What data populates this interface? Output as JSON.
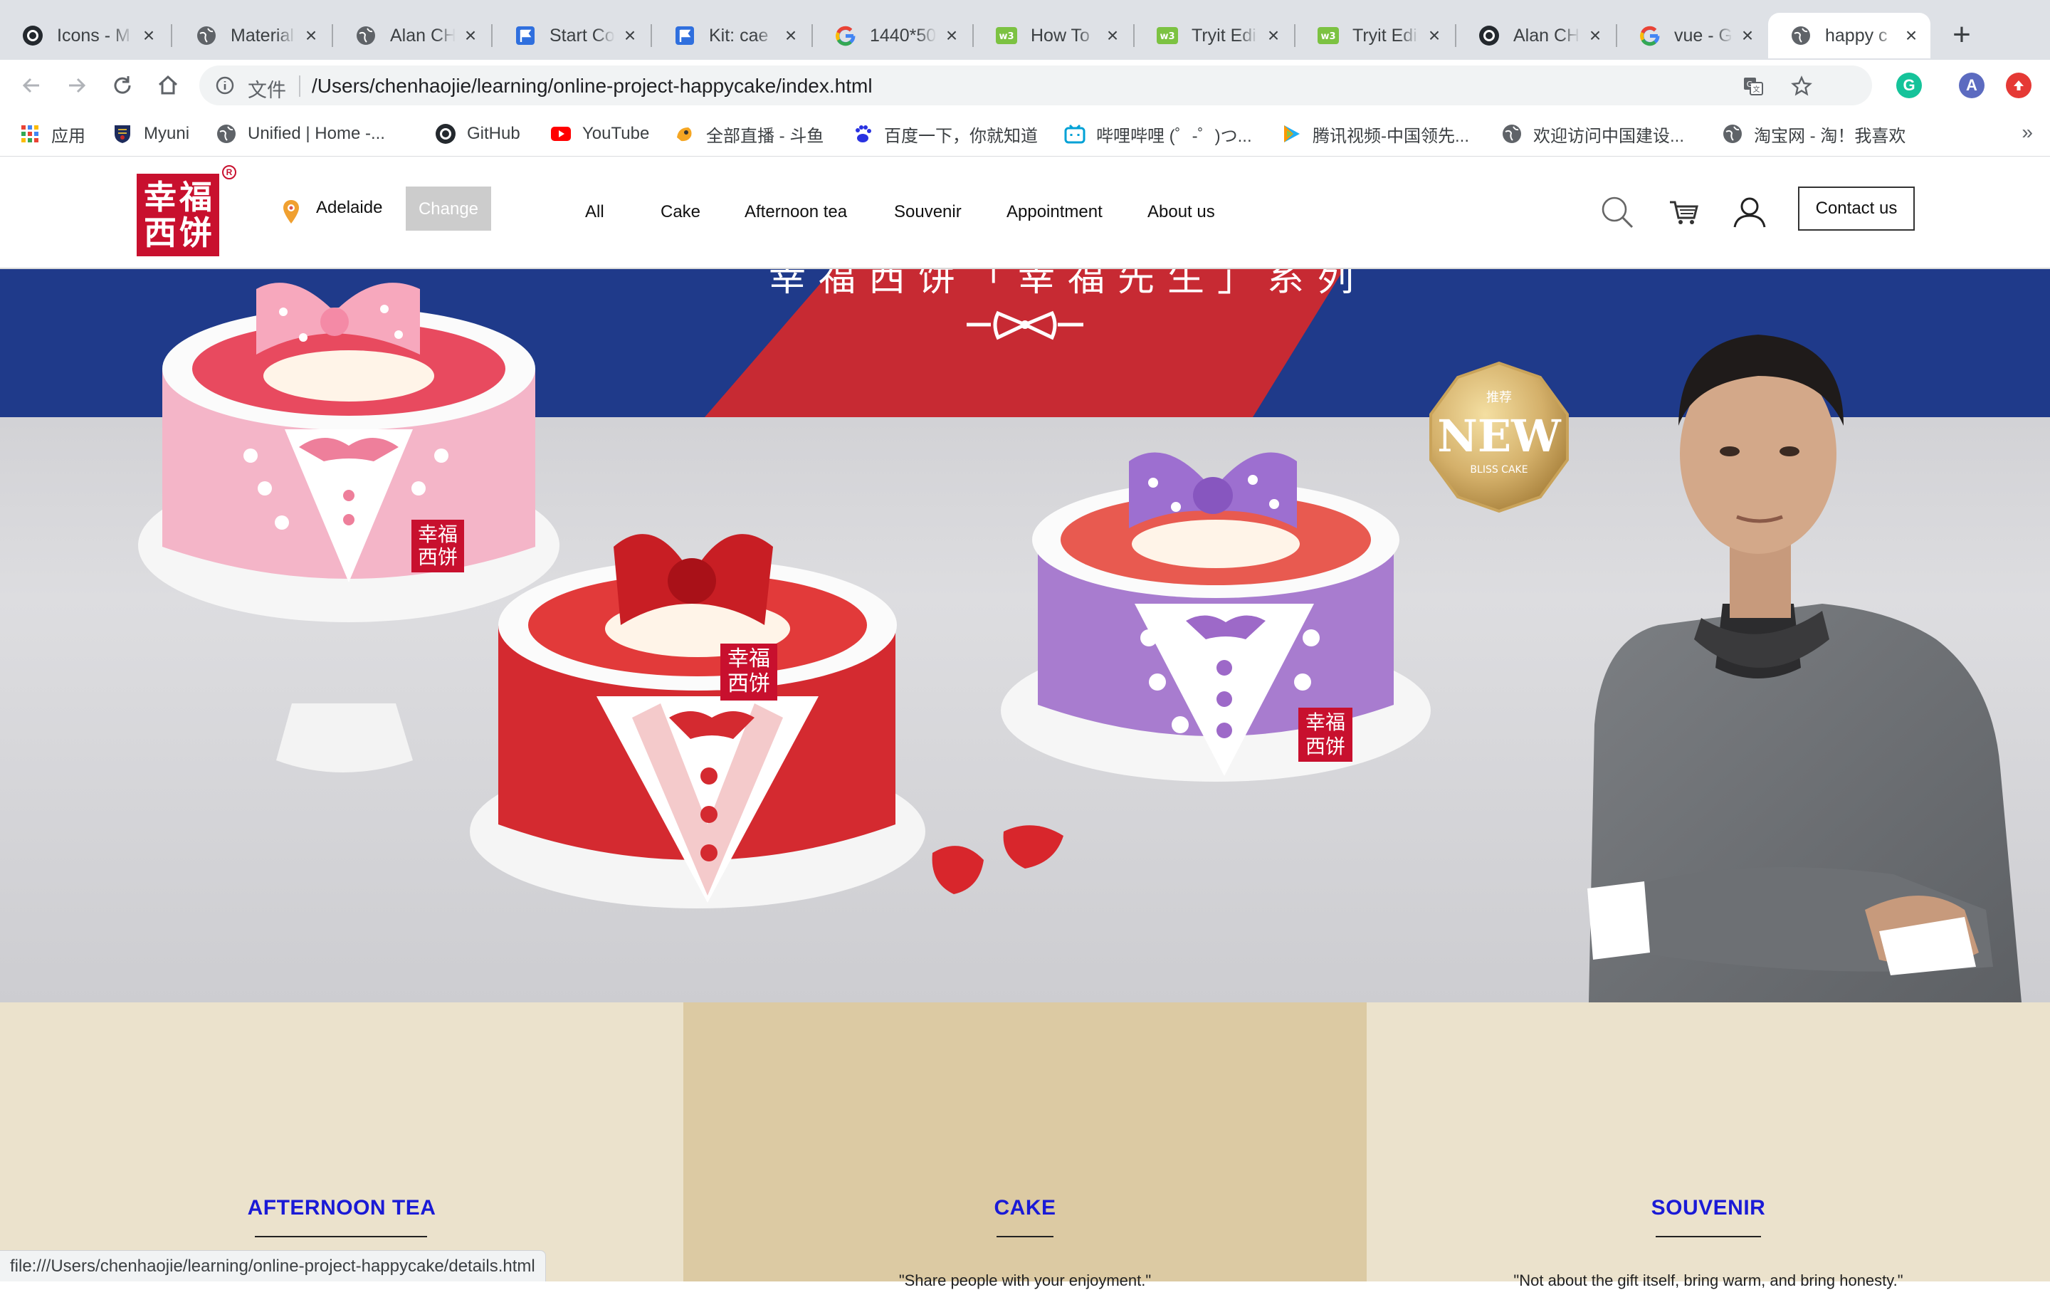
{
  "browser": {
    "tabs": [
      {
        "title": "Icons - M",
        "icon": "github-icon"
      },
      {
        "title": "Material",
        "icon": "globe-icon"
      },
      {
        "title": "Alan CH",
        "icon": "globe-icon"
      },
      {
        "title": "Start Co",
        "icon": "flag-icon"
      },
      {
        "title": "Kit: cae",
        "icon": "flag-icon"
      },
      {
        "title": "1440*50",
        "icon": "google-icon"
      },
      {
        "title": "How To",
        "icon": "wechat-icon"
      },
      {
        "title": "Tryit Edi",
        "icon": "wechat-icon"
      },
      {
        "title": "Tryit Edi",
        "icon": "wechat-icon"
      },
      {
        "title": "Alan CH",
        "icon": "github-icon"
      },
      {
        "title": "vue - Go",
        "icon": "google-icon"
      },
      {
        "title": "happy c",
        "icon": "globe-icon",
        "active": true
      }
    ],
    "omnibox": {
      "scheme_label": "文件",
      "url": "/Users/chenhaojie/learning/online-project-happycake/index.html"
    },
    "profile_initial": "A",
    "grammarly_letter": "G",
    "bookmarks": [
      {
        "label": "应用",
        "icon": "apps-grid-icon"
      },
      {
        "label": "Myuni",
        "icon": "shield-crest-icon"
      },
      {
        "label": "Unified | Home -...",
        "icon": "globe-icon"
      },
      {
        "label": "GitHub",
        "icon": "github-icon"
      },
      {
        "label": "YouTube",
        "icon": "youtube-icon"
      },
      {
        "label": "全部直播 - 斗鱼",
        "icon": "douyu-icon"
      },
      {
        "label": "百度一下，你就知道",
        "icon": "baidu-icon"
      },
      {
        "label": "哔哩哔哩 (゜-゜)つ...",
        "icon": "bilibili-icon"
      },
      {
        "label": "腾讯视频-中国领先...",
        "icon": "tencent-video-icon"
      },
      {
        "label": "欢迎访问中国建设...",
        "icon": "globe-icon"
      },
      {
        "label": "淘宝网 - 淘！我喜欢",
        "icon": "globe-icon"
      }
    ],
    "bookmarks_overflow": "»",
    "status_url": "file:///Users/chenhaojie/learning/online-project-happycake/details.html"
  },
  "site": {
    "logo_chars": [
      "幸",
      "福",
      "西",
      "饼"
    ],
    "logo_reg": "R",
    "location": {
      "city": "Adelaide",
      "change_label": "Change"
    },
    "nav": [
      "All",
      "Cake",
      "Afternoon tea",
      "Souvenir",
      "Appointment",
      "About us"
    ],
    "contact_label": "Contact us",
    "hero": {
      "headline": "幸福西饼「幸福先生」系列",
      "badge_top": "推荐",
      "badge_main": "NEW",
      "badge_sub": "BLISS CAKE",
      "cake_stamp": [
        "幸福",
        "西饼"
      ]
    },
    "features": [
      {
        "title": "AFTERNOON TEA",
        "quote": "",
        "bg": "#ebe2cc"
      },
      {
        "title": "CAKE",
        "quote": "\"Share people with your enjoyment.\"",
        "bg": "#dccaa3"
      },
      {
        "title": "SOUVENIR",
        "quote": "\"Not about the gift itself, bring warm, and bring honesty.\"",
        "bg": "#ebe2cc"
      }
    ]
  },
  "colors": {
    "brand_red": "#c8102e",
    "banner_blue": "#1f3a8a",
    "feature_title_blue": "#1a1ad6"
  }
}
